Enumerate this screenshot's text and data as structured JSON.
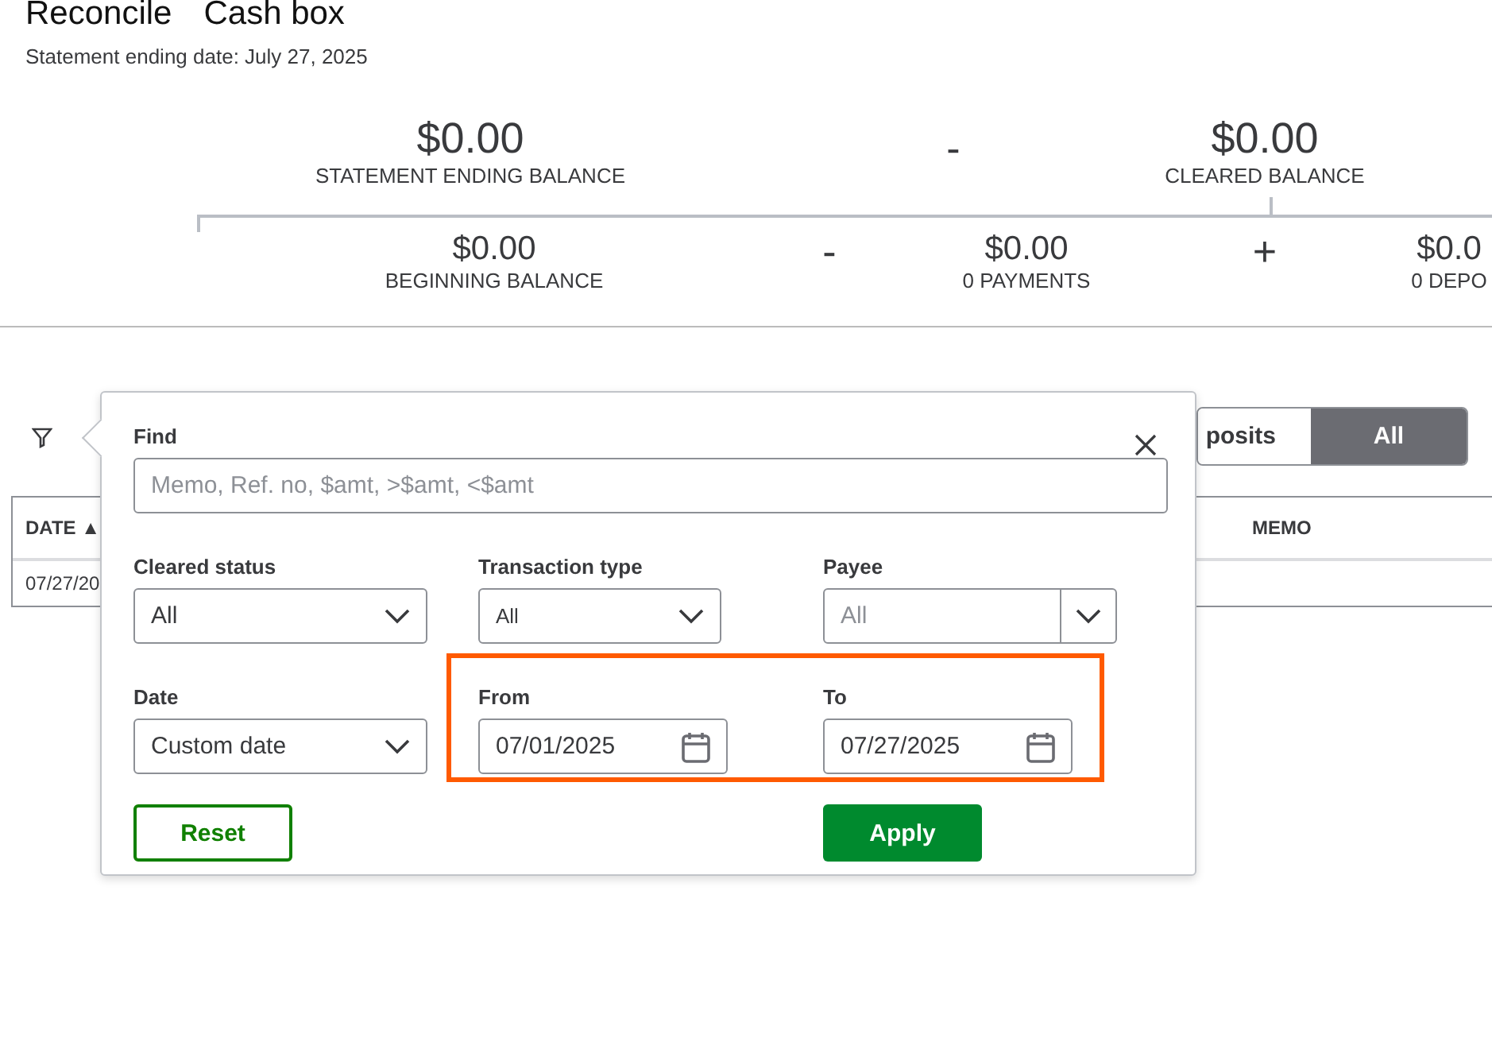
{
  "header": {
    "title": "Reconcile",
    "account": "Cash box",
    "statement_date": "Statement ending date: July 27, 2025"
  },
  "summary": {
    "top": [
      {
        "kind": "value",
        "amount": "$0.00",
        "label": "STATEMENT ENDING BALANCE"
      },
      {
        "kind": "operator",
        "symbol": "-"
      },
      {
        "kind": "value",
        "amount": "$0.00",
        "label": "CLEARED BALANCE"
      }
    ],
    "bottom": [
      {
        "kind": "value",
        "amount": "$0.00",
        "label": "BEGINNING BALANCE"
      },
      {
        "kind": "operator",
        "symbol": "-"
      },
      {
        "kind": "value",
        "amount": "$0.00",
        "label": "0 PAYMENTS"
      },
      {
        "kind": "operator",
        "symbol": "+"
      },
      {
        "kind": "value",
        "amount": "$0.0",
        "label": "0 DEPO"
      }
    ]
  },
  "segments": [
    {
      "label": "posits",
      "selected": false
    },
    {
      "label": "All",
      "selected": true
    }
  ],
  "table": {
    "columns": [
      "DATE ▲",
      "MEMO"
    ],
    "rows": [
      [
        "07/27/20"
      ]
    ]
  },
  "filter": {
    "find": {
      "label": "Find",
      "placeholder": "Memo, Ref. no, $amt, >$amt, <$amt"
    },
    "fields": [
      {
        "kind": "select",
        "label": "Cleared status",
        "value": "All"
      },
      {
        "kind": "select",
        "label": "Transaction type",
        "value": "All"
      },
      {
        "kind": "combo",
        "label": "Payee",
        "placeholder": "All"
      },
      {
        "kind": "select",
        "label": "Date",
        "value": "Custom date"
      },
      {
        "kind": "date",
        "label": "From",
        "value": "07/01/2025"
      },
      {
        "kind": "date",
        "label": "To",
        "value": "07/27/2025"
      }
    ],
    "buttons": [
      {
        "kind": "secondary",
        "label": "Reset"
      },
      {
        "kind": "primary",
        "label": "Apply"
      }
    ]
  }
}
